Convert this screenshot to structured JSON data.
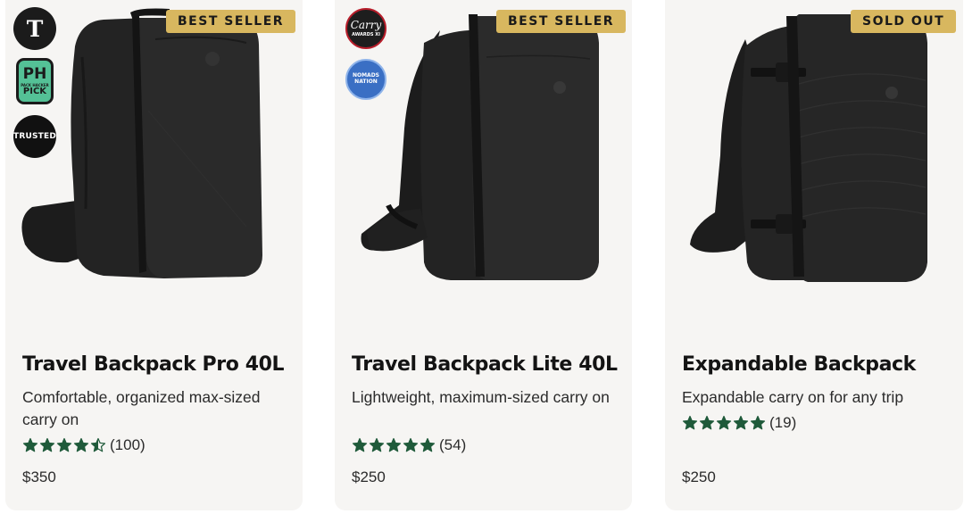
{
  "products": [
    {
      "badge": "BEST SELLER",
      "title": "Travel Backpack Pro 40L",
      "description": "Comfortable, organized max-sized carry on",
      "rating_count": "(100)",
      "rating_value": 4.5,
      "price": "$350",
      "awards": [
        "T",
        "PH",
        "PACK HACKER",
        "PICK",
        "TRUSTED"
      ]
    },
    {
      "badge": "BEST SELLER",
      "title": "Travel Backpack Lite 40L",
      "description": "Lightweight, maximum-sized carry on",
      "rating_count": "(54)",
      "rating_value": 5,
      "price": "$250",
      "awards": [
        "Carry",
        "AWARDS XI",
        "NOMADS NATION"
      ]
    },
    {
      "badge": "SOLD OUT",
      "title": "Expandable Backpack",
      "description": "Expandable carry on for any trip",
      "rating_count": "(19)",
      "rating_value": 5,
      "price": "$250",
      "awards": []
    }
  ],
  "colors": {
    "card_bg": "#f6f5f3",
    "badge_bg": "#d8b75f",
    "star": "#1f5a3a",
    "text": "#141414"
  },
  "icons": [
    "star-icon",
    "backpack-image"
  ]
}
